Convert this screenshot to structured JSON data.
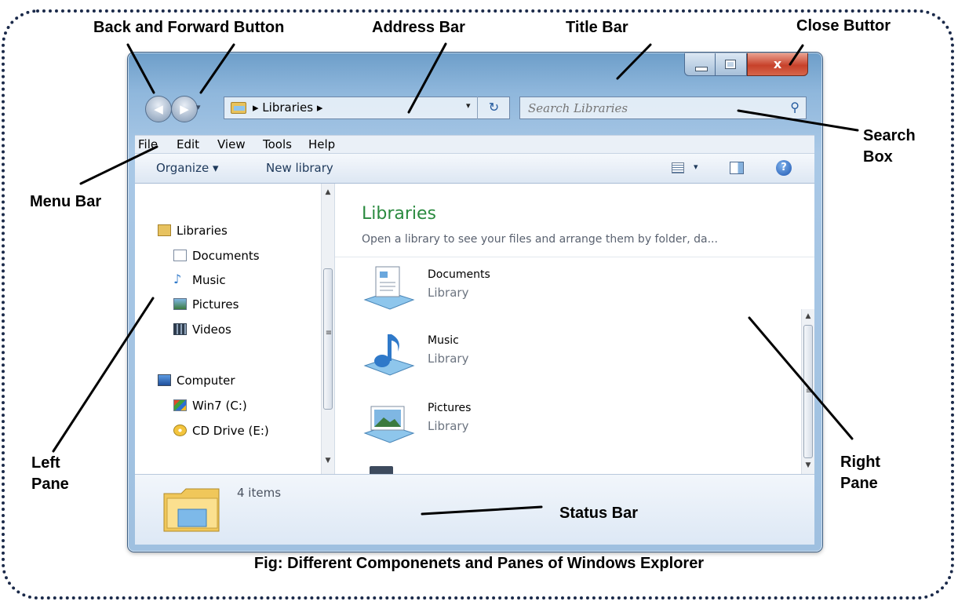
{
  "caption": "Fig: Different Componenets and Panes of Windows Explorer",
  "callouts": {
    "back_forward": "Back and Forward Button",
    "address_bar": "Address Bar",
    "title_bar": "Title Bar",
    "close_button": "Close Buttor",
    "search_box_1": "Search",
    "search_box_2": "Box",
    "menu_bar": "Menu Bar",
    "left_pane_1": "Left",
    "left_pane_2": "Pane",
    "right_pane_1": "Right",
    "right_pane_2": "Pane",
    "status_bar": "Status Bar"
  },
  "window": {
    "close_glyph": "x",
    "nav": {
      "back_glyph": "◀",
      "forward_glyph": "▶",
      "dropdown_glyph": "▾"
    },
    "address": {
      "crumb": "▸ Libraries ▸",
      "dropdown_glyph": "▾",
      "refresh_glyph": "↻"
    },
    "search": {
      "placeholder": "Search Libraries",
      "icon": "magnifier-icon"
    },
    "menu": [
      "File",
      "Edit",
      "View",
      "Tools",
      "Help"
    ],
    "toolbar": {
      "organize": "Organize ▾",
      "new_library": "New library",
      "view_dropdown": "▾",
      "help": "?"
    },
    "left_pane": {
      "items": [
        {
          "label": "Libraries",
          "icon": "libraries-folder-icon"
        },
        {
          "label": "Documents",
          "icon": "documents-icon"
        },
        {
          "label": "Music",
          "icon": "music-note-icon"
        },
        {
          "label": "Pictures",
          "icon": "pictures-icon"
        },
        {
          "label": "Videos",
          "icon": "videos-icon"
        },
        {
          "label": "Computer",
          "icon": "computer-icon"
        },
        {
          "label": "Win7 (C:)",
          "icon": "drive-icon"
        },
        {
          "label": "CD Drive (E:)",
          "icon": "cd-drive-icon"
        }
      ],
      "scroll_up": "▲",
      "scroll_down": "▼",
      "grip": "≡"
    },
    "right_pane": {
      "title": "Libraries",
      "subtitle": "Open a library to see your files and arrange them by folder, da...",
      "libraries": [
        {
          "name": "Documents",
          "kind": "Library",
          "icon": "documents-library-icon"
        },
        {
          "name": "Music",
          "kind": "Library",
          "icon": "music-library-icon"
        },
        {
          "name": "Pictures",
          "kind": "Library",
          "icon": "pictures-library-icon"
        }
      ],
      "scroll_up": "▲",
      "scroll_down": "▼",
      "grip": "≡"
    },
    "status": {
      "count": "4 items",
      "icon": "libraries-folder-icon"
    }
  },
  "colors": {
    "frame": "#1b2a4a",
    "title_gradient_top": "#6d9ec9",
    "close_red": "#c7412a",
    "pane_title_green": "#2a8a3f"
  }
}
